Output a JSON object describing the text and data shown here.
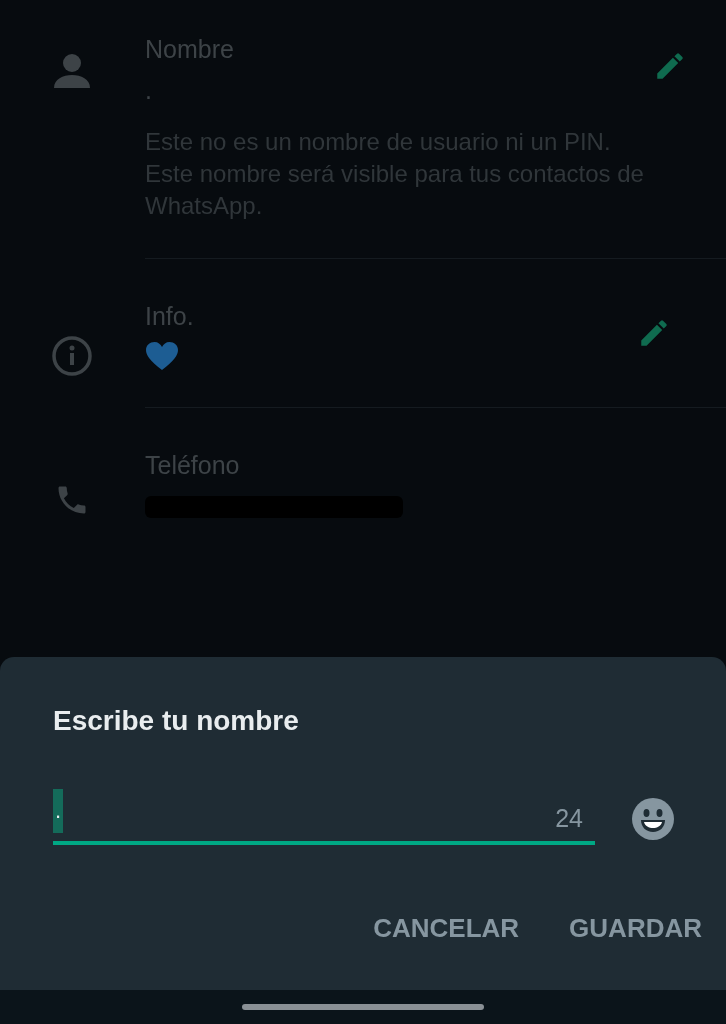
{
  "profile": {
    "rows": [
      {
        "kind": "name",
        "label": "Nombre",
        "value": ".",
        "hint": "Este no es un nombre de usuario ni un PIN. Este nombre será visible para tus contactos de WhatsApp.",
        "editable": true
      },
      {
        "kind": "info",
        "label": "Info.",
        "editable": true
      },
      {
        "kind": "phone",
        "label": "Teléfono",
        "editable": false
      }
    ]
  },
  "dialog": {
    "title": "Escribe tu nombre",
    "field": {
      "value": ".",
      "counter": "24"
    },
    "buttons": [
      "CANCELAR",
      "GUARDAR"
    ]
  }
}
